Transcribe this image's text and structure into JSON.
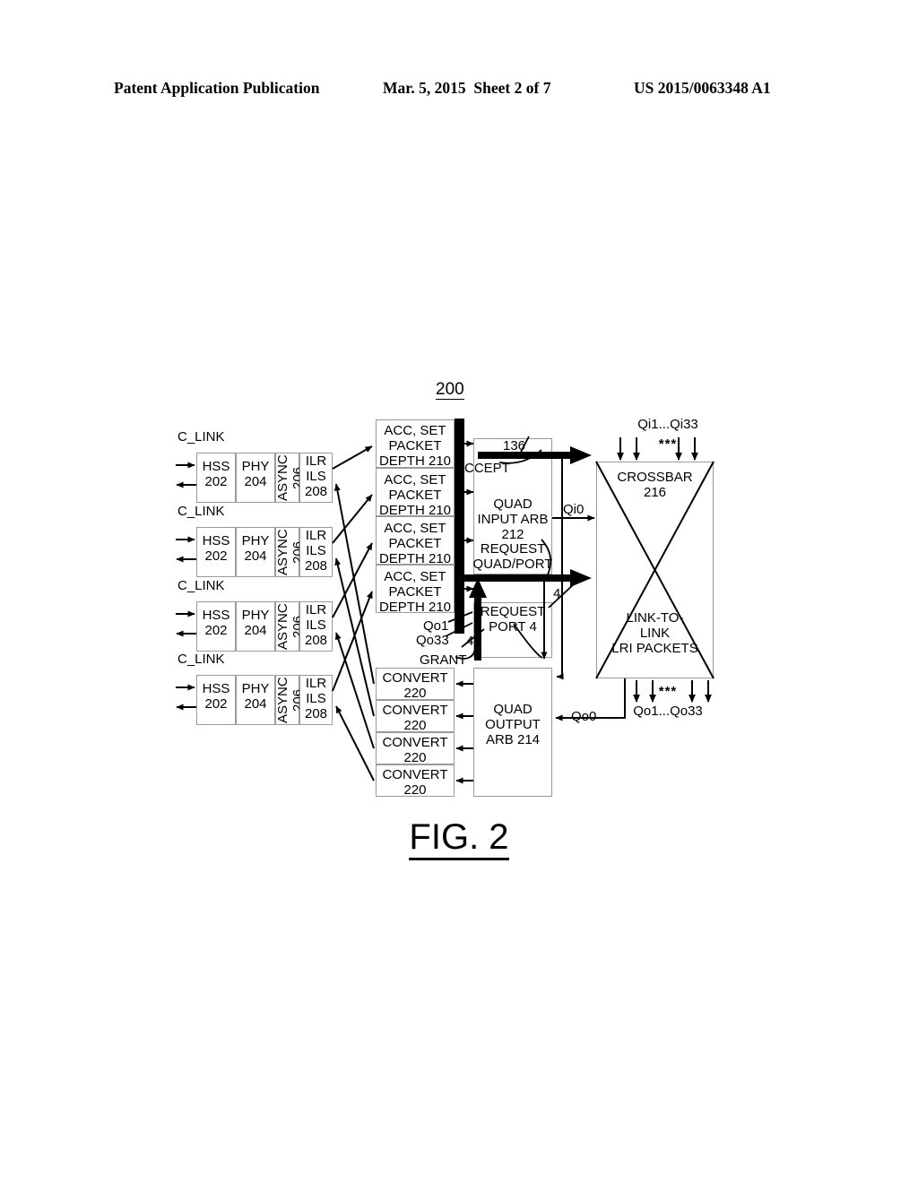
{
  "header": {
    "publication": "Patent Application Publication",
    "date_sheet": "Mar. 5, 2015  Sheet 2 of 7",
    "patent_number": "US 2015/0063348 A1"
  },
  "figure": {
    "caption": "FIG. 2",
    "ref_numeral": "200"
  },
  "links": {
    "label": "C_LINK",
    "cells": {
      "hss": "HSS\n202",
      "phy": "PHY\n204",
      "async": "ASYNC\n206",
      "ilr": "ILR\nILS\n208"
    },
    "rows": [
      {
        "label": "C_LINK"
      },
      {
        "label": "C_LINK"
      },
      {
        "label": "C_LINK"
      },
      {
        "label": "C_LINK"
      }
    ]
  },
  "acc_blocks": [
    {
      "label": "ACC, SET\nPACKET\nDEPTH 210"
    },
    {
      "label": "ACC, SET\nPACKET\nDEPTH 210"
    },
    {
      "label": "ACC, SET\nPACKET\nDEPTH 210"
    },
    {
      "label": "ACC, SET\nPACKET\nDEPTH 210"
    }
  ],
  "convert_blocks": [
    {
      "label": "CONVERT\n220"
    },
    {
      "label": "CONVERT\n220"
    },
    {
      "label": "CONVERT\n220"
    },
    {
      "label": "CONVERT\n220"
    }
  ],
  "quad_input_arb": {
    "title": "QUAD\nINPUT ARB\n212",
    "accept_ref": "136",
    "accept_label": "ACCEPT",
    "request_quad_port": "REQUEST\nQUAD/PORT"
  },
  "request_port": {
    "title": "REQUEST\nPORT 4",
    "qo1": "Qo1",
    "qo33": "Qo33",
    "grant": "GRANT",
    "width_a": "4",
    "width_b": "4",
    "width_c": "4"
  },
  "quad_output_arb": {
    "title": "QUAD\nOUTPUT\nARB 214"
  },
  "crossbar": {
    "title_top": "CROSSBAR\n216",
    "title_bottom": "LINK-TO-\nLINK\nLRI PACKETS",
    "inputs_label": "Qi1...Qi33",
    "outputs_label": "Qo1...Qo33",
    "ellipsis": "***"
  },
  "signals": {
    "qi0": "Qi0",
    "qo0": "Qo0"
  }
}
